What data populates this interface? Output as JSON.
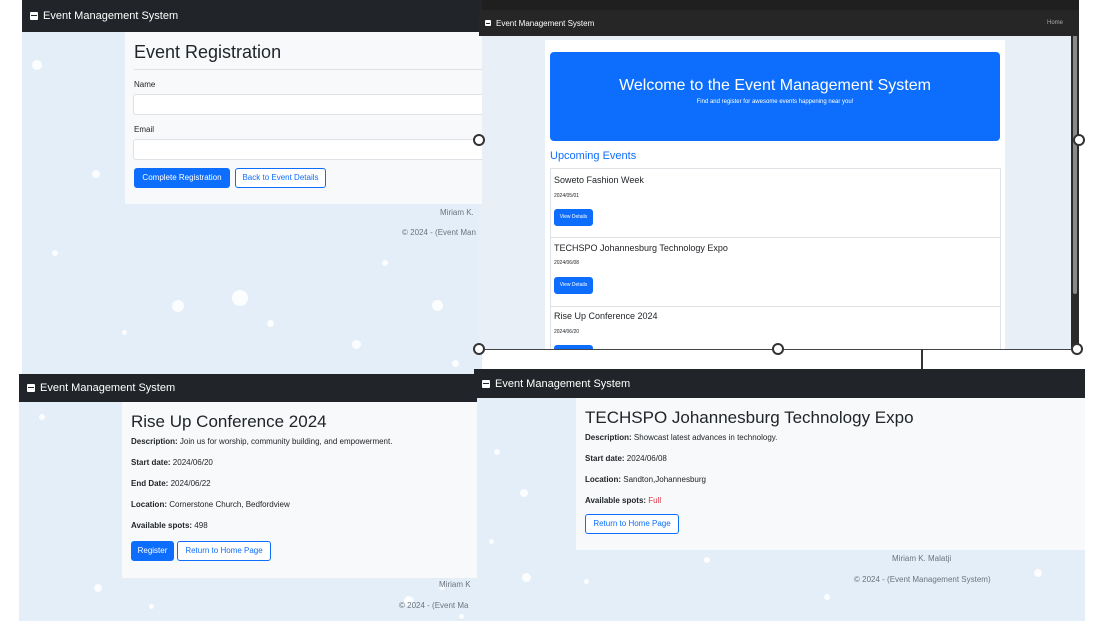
{
  "app_name": "Event Management System",
  "colors": {
    "primary": "#0d6efd",
    "navbar": "#212529",
    "danger": "#dc3545",
    "bg": "#e4eef8"
  },
  "registration": {
    "title": "Event Registration",
    "name_label": "Name",
    "email_label": "Email",
    "complete_button": "Complete Registration",
    "back_button": "Back to Event Details",
    "footer_author": "Miriam K.",
    "footer_copy": "© 2024 - (Event Man"
  },
  "home": {
    "nav_home": "Home",
    "hero_title": "Welcome to the Event Management System",
    "hero_subtitle": "Find and register for awesome events happening near you!",
    "upcoming_heading": "Upcoming Events",
    "view_details": "View Details",
    "events": [
      {
        "name": "Soweto Fashion Week",
        "date": "2024/05/01"
      },
      {
        "name": "TECHSPO Johannesburg Technology Expo",
        "date": "2024/06/08"
      },
      {
        "name": "Rise Up Conference 2024",
        "date": "2024/06/20"
      }
    ]
  },
  "rise_up": {
    "title": "Rise Up Conference 2024",
    "description_label": "Description:",
    "description": "Join us for worship, community building, and empowerment.",
    "start_label": "Start date:",
    "start": "2024/06/20",
    "end_label": "End Date:",
    "end": "2024/06/22",
    "location_label": "Location:",
    "location": "Cornerstone Church, Bedfordview",
    "spots_label": "Available spots:",
    "spots": "498",
    "register_button": "Register",
    "home_button": "Return to Home Page",
    "footer_author": "Miriam K",
    "footer_copy": "© 2024 - (Event Ma"
  },
  "techspo": {
    "title": "TECHSPO Johannesburg Technology Expo",
    "description_label": "Description:",
    "description": "Showcast latest advances in technology.",
    "start_label": "Start date:",
    "start": "2024/06/08",
    "location_label": "Location:",
    "location": "Sandton,Johannesburg",
    "spots_label": "Available spots:",
    "spots": "Full",
    "home_button": "Return to Home Page",
    "footer_author": "Miriam K. Malatji",
    "footer_copy": "© 2024 - (Event Management System)"
  }
}
